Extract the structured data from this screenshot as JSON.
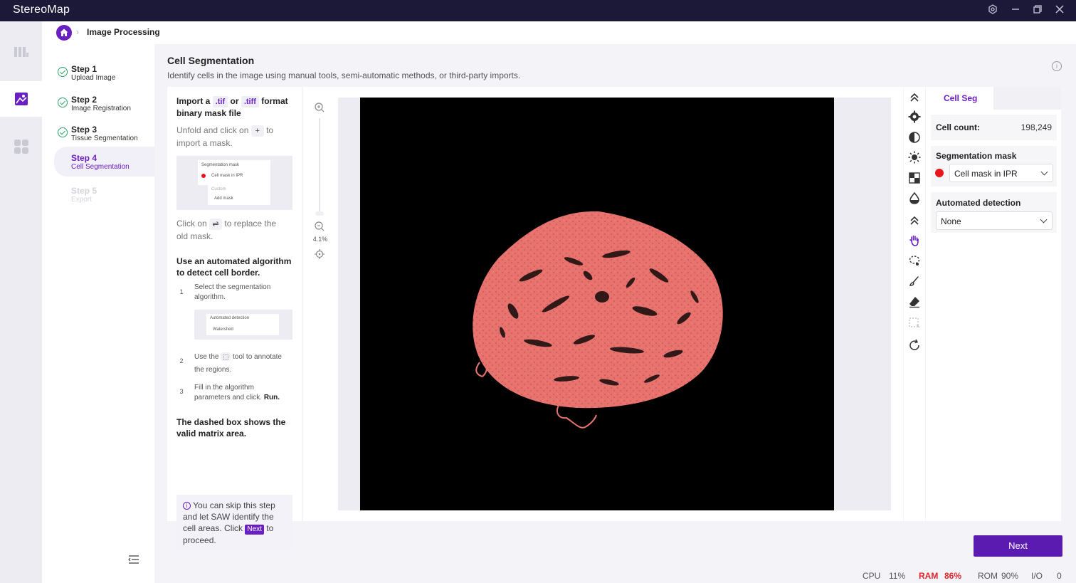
{
  "app": {
    "title": "StereoMap"
  },
  "breadcrumb": {
    "current": "Image Processing"
  },
  "steps": [
    {
      "title": "Step 1",
      "subtitle": "Upload Image",
      "state": "done"
    },
    {
      "title": "Step 2",
      "subtitle": "Image Registration",
      "state": "done"
    },
    {
      "title": "Step 3",
      "subtitle": "Tissue Segmentation",
      "state": "done"
    },
    {
      "title": "Step 4",
      "subtitle": "Cell Segmentation",
      "state": "active"
    },
    {
      "title": "Step 5",
      "subtitle": "Export",
      "state": "disabled"
    }
  ],
  "page": {
    "title": "Cell Segmentation",
    "description": "Identify cells in the image using manual tools, semi-automatic methods, or third-party imports."
  },
  "guide": {
    "import_a": "Import a",
    "tif": ".tif",
    "or": "or",
    "tiff": ".tiff",
    "format": "format",
    "binary_mask": "binary mask file",
    "unfold_1": "Unfold and click on",
    "unfold_2": "to",
    "unfold_3": "import a mask.",
    "thumb1_header": "Segmentation mask",
    "thumb1_option": "Cell mask in IPR",
    "thumb1_custom": "Custom",
    "thumb1_add": "Add mask",
    "click_on": "Click on",
    "replace_1": "to replace the",
    "replace_2": "old mask.",
    "auto_title_1": "Use an automated algorithm",
    "auto_title_2": "to detect cell border.",
    "item1_num": "1",
    "item1_a": "Select the segmentation",
    "item1_b": "algorithm.",
    "thumb2_header": "Automated detection",
    "thumb2_option": "Watershed",
    "item2_num": "2",
    "item2_a": "Use the",
    "item2_b": "tool to annotate",
    "item2_c": "the regions.",
    "item3_num": "3",
    "item3_a": "Fill in the algorithm",
    "item3_b": "parameters and click.",
    "item3_run": "Run.",
    "dashed_1": "The dashed box shows the",
    "dashed_2": "valid matrix area.",
    "tip_1": "You can skip this step",
    "tip_2": "and let SAW identify the",
    "tip_3": "cell areas. Click",
    "tip_next": "Next",
    "tip_4": "to",
    "tip_5": "proceed."
  },
  "zoom": {
    "level": "4.1%",
    "slider_fraction": 0.02
  },
  "right_panel": {
    "tab": "Cell Seg",
    "cell_count_label": "Cell count:",
    "cell_count_value": "198,249",
    "seg_mask_label": "Segmentation mask",
    "seg_mask_value": "Cell mask in IPR",
    "seg_mask_color": "#e8141c",
    "auto_label": "Automated detection",
    "auto_value": "None"
  },
  "actions": {
    "next": "Next"
  },
  "status": {
    "cpu_label": "CPU",
    "cpu_value": "11%",
    "ram_label": "RAM",
    "ram_value": "86%",
    "rom_label": "ROM",
    "rom_value": "90%",
    "io_label": "I/O",
    "io_value": "0"
  },
  "colors": {
    "accent": "#6a1fc2",
    "titlebar": "#1b1838",
    "tissue": "#e8736e",
    "alert": "#e0242c"
  }
}
